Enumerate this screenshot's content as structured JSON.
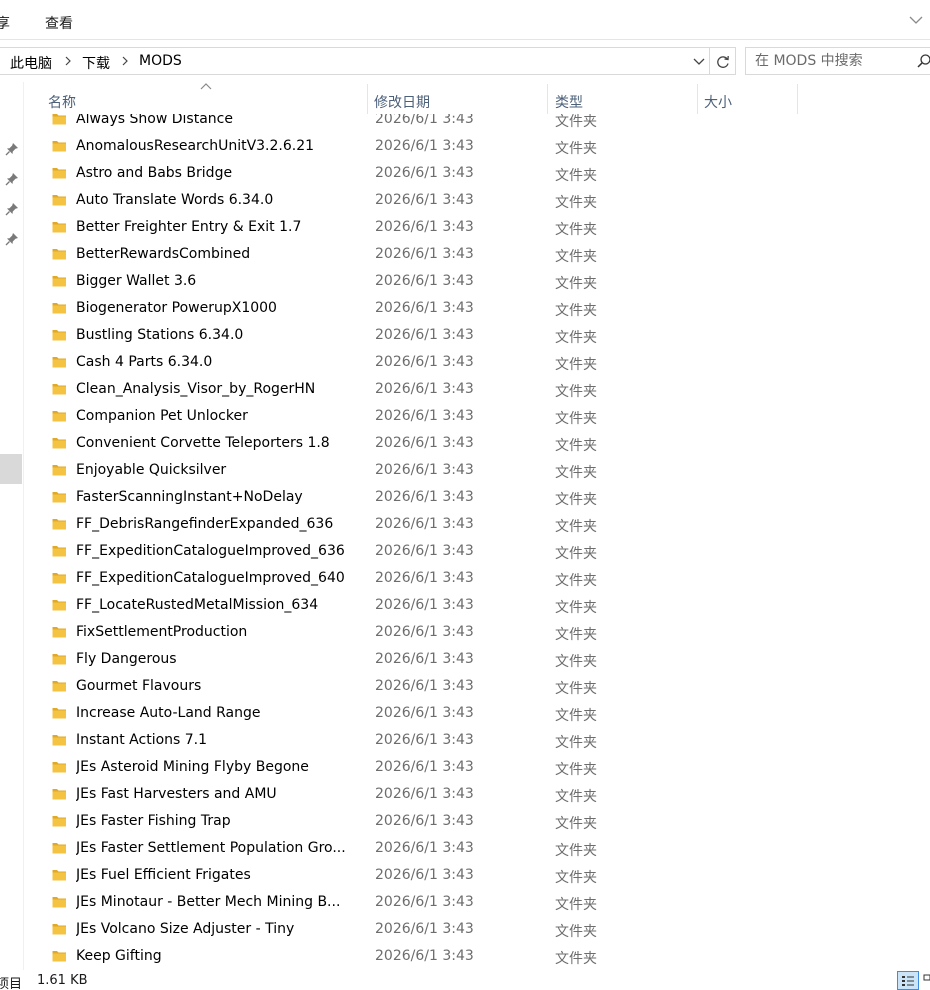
{
  "ribbon": {
    "tabs": [
      "享",
      "查看"
    ]
  },
  "address": {
    "crumbs": [
      "此电脑",
      "下载",
      "MODS"
    ],
    "search_placeholder": "在 MODS 中搜索"
  },
  "columns": {
    "name": "名称",
    "date": "修改日期",
    "type": "类型",
    "size": "大小"
  },
  "files": [
    {
      "name": "Always Show Distance",
      "date": "2026/6/1 3:43",
      "type": "文件夹"
    },
    {
      "name": "AnomalousResearchUnitV3.2.6.21",
      "date": "2026/6/1 3:43",
      "type": "文件夹"
    },
    {
      "name": "Astro and Babs Bridge",
      "date": "2026/6/1 3:43",
      "type": "文件夹"
    },
    {
      "name": "Auto Translate Words 6.34.0",
      "date": "2026/6/1 3:43",
      "type": "文件夹"
    },
    {
      "name": "Better Freighter Entry & Exit 1.7",
      "date": "2026/6/1 3:43",
      "type": "文件夹"
    },
    {
      "name": "BetterRewardsCombined",
      "date": "2026/6/1 3:43",
      "type": "文件夹"
    },
    {
      "name": "Bigger Wallet 3.6",
      "date": "2026/6/1 3:43",
      "type": "文件夹"
    },
    {
      "name": "Biogenerator PowerupX1000",
      "date": "2026/6/1 3:43",
      "type": "文件夹"
    },
    {
      "name": "Bustling Stations 6.34.0",
      "date": "2026/6/1 3:43",
      "type": "文件夹"
    },
    {
      "name": "Cash 4 Parts 6.34.0",
      "date": "2026/6/1 3:43",
      "type": "文件夹"
    },
    {
      "name": "Clean_Analysis_Visor_by_RogerHN",
      "date": "2026/6/1 3:43",
      "type": "文件夹"
    },
    {
      "name": "Companion Pet Unlocker",
      "date": "2026/6/1 3:43",
      "type": "文件夹"
    },
    {
      "name": "Convenient Corvette Teleporters 1.8",
      "date": "2026/6/1 3:43",
      "type": "文件夹"
    },
    {
      "name": "Enjoyable Quicksilver",
      "date": "2026/6/1 3:43",
      "type": "文件夹"
    },
    {
      "name": "FasterScanningInstant+NoDelay",
      "date": "2026/6/1 3:43",
      "type": "文件夹"
    },
    {
      "name": "FF_DebrisRangefinderExpanded_636",
      "date": "2026/6/1 3:43",
      "type": "文件夹"
    },
    {
      "name": "FF_ExpeditionCatalogueImproved_636",
      "date": "2026/6/1 3:43",
      "type": "文件夹"
    },
    {
      "name": "FF_ExpeditionCatalogueImproved_640",
      "date": "2026/6/1 3:43",
      "type": "文件夹"
    },
    {
      "name": "FF_LocateRustedMetalMission_634",
      "date": "2026/6/1 3:43",
      "type": "文件夹"
    },
    {
      "name": "FixSettlementProduction",
      "date": "2026/6/1 3:43",
      "type": "文件夹"
    },
    {
      "name": "Fly Dangerous",
      "date": "2026/6/1 3:43",
      "type": "文件夹"
    },
    {
      "name": "Gourmet Flavours",
      "date": "2026/6/1 3:43",
      "type": "文件夹"
    },
    {
      "name": "Increase Auto-Land Range",
      "date": "2026/6/1 3:43",
      "type": "文件夹"
    },
    {
      "name": "Instant Actions 7.1",
      "date": "2026/6/1 3:43",
      "type": "文件夹"
    },
    {
      "name": "JEs Asteroid Mining Flyby Begone",
      "date": "2026/6/1 3:43",
      "type": "文件夹"
    },
    {
      "name": "JEs Fast Harvesters and AMU",
      "date": "2026/6/1 3:43",
      "type": "文件夹"
    },
    {
      "name": "JEs Faster Fishing Trap",
      "date": "2026/6/1 3:43",
      "type": "文件夹"
    },
    {
      "name": "JEs Faster Settlement Population Gro...",
      "date": "2026/6/1 3:43",
      "type": "文件夹"
    },
    {
      "name": "JEs Fuel Efficient Frigates",
      "date": "2026/6/1 3:43",
      "type": "文件夹"
    },
    {
      "name": "JEs Minotaur - Better Mech Mining B...",
      "date": "2026/6/1 3:43",
      "type": "文件夹"
    },
    {
      "name": "JEs Volcano Size Adjuster - Tiny",
      "date": "2026/6/1 3:43",
      "type": "文件夹"
    },
    {
      "name": "Keep Gifting",
      "date": "2026/6/1 3:43",
      "type": "文件夹"
    }
  ],
  "status": {
    "items_label": "项目",
    "size": "1.61 KB"
  },
  "colors": {
    "folder": "#f5c342",
    "folder_dark": "#e0a92a",
    "header_text": "#4c607a",
    "meta_text": "#6d6d6d"
  },
  "icons": [
    "pin-icon",
    "folder-icon",
    "search-icon",
    "refresh-icon",
    "chevron-down-icon",
    "details-view-icon",
    "tiles-view-icon"
  ]
}
